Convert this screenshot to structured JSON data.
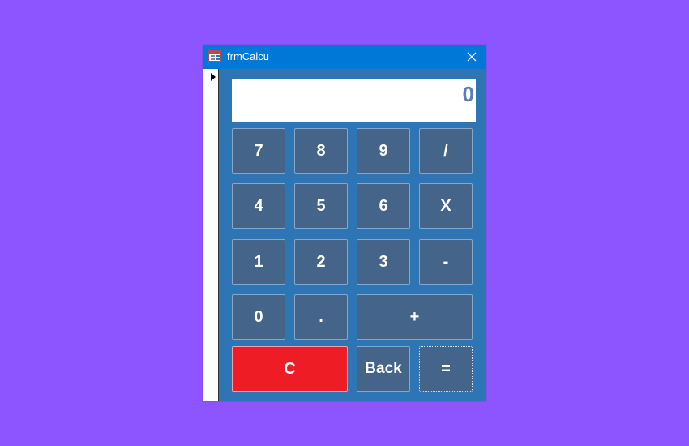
{
  "window": {
    "title": "frmCalcu",
    "app_icon": "access-form-icon",
    "close_icon": "close-icon"
  },
  "display": {
    "value": "0"
  },
  "keys": {
    "k7": "7",
    "k8": "8",
    "k9": "9",
    "divide": "/",
    "k4": "4",
    "k5": "5",
    "k6": "6",
    "multiply": "X",
    "k1": "1",
    "k2": "2",
    "k3": "3",
    "minus": "-",
    "k0": "0",
    "dot": ".",
    "plus": "+",
    "clear": "C",
    "back": "Back",
    "equals": "="
  },
  "colors": {
    "background": "#8c55ff",
    "titlebar": "#0078d7",
    "form": "#2e75b6",
    "key": "#44648a",
    "clear_key": "#ee1c25",
    "display_text": "#5b7db8"
  }
}
